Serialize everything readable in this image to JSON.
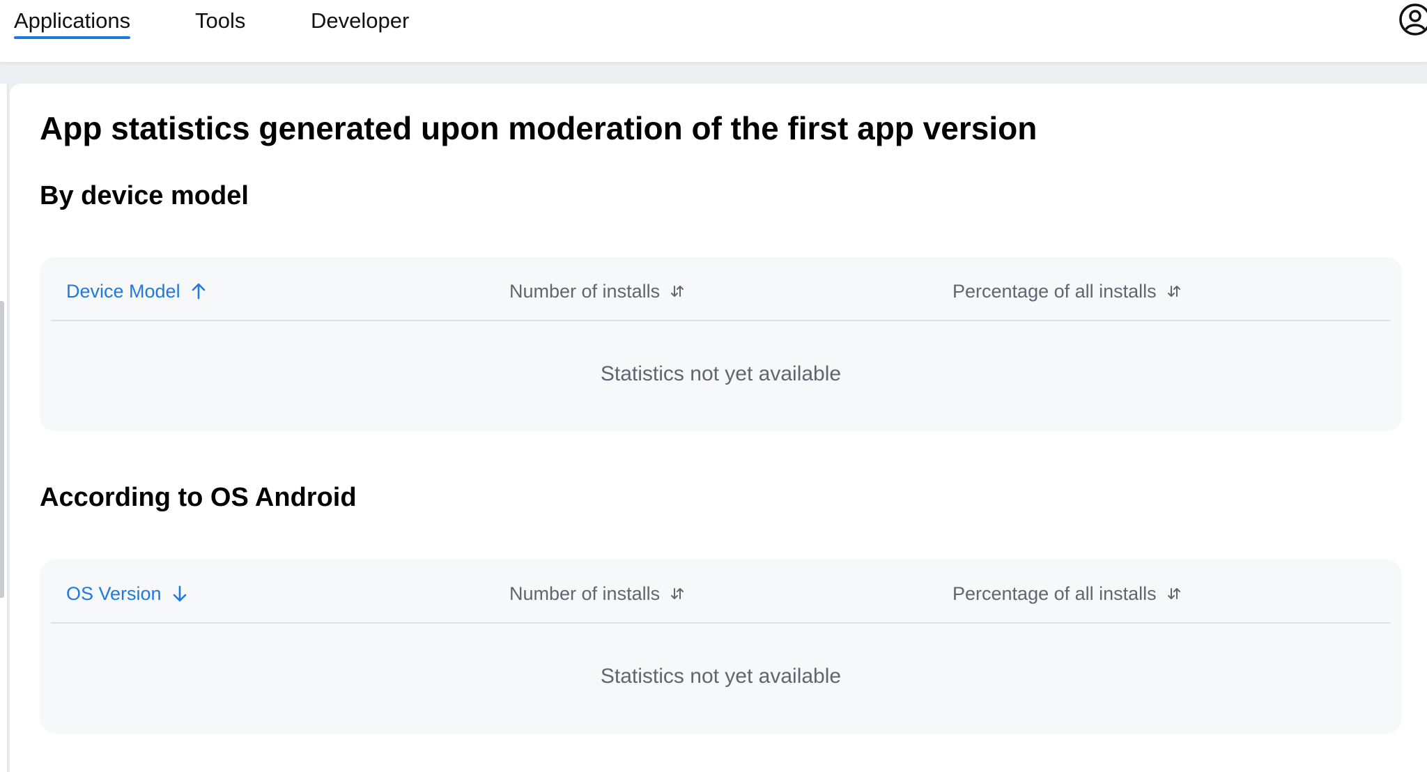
{
  "nav": {
    "tabs": [
      {
        "label": "Applications",
        "active": true
      },
      {
        "label": "Tools",
        "active": false
      },
      {
        "label": "Developer",
        "active": false
      }
    ],
    "avatar_icon": "user-circle-icon"
  },
  "page": {
    "title": "App statistics generated upon moderation of the first app version"
  },
  "sections": [
    {
      "title": "By device model",
      "columns": [
        {
          "label": "Device Model",
          "sort": "ascending",
          "icon": "arrow-up-icon",
          "active": true
        },
        {
          "label": "Number of installs",
          "sort": "none",
          "icon": "sort-arrows-icon",
          "active": false
        },
        {
          "label": "Percentage of all installs",
          "sort": "none",
          "icon": "sort-arrows-icon",
          "active": false
        }
      ],
      "empty_message": "Statistics not yet available"
    },
    {
      "title": "According to OS Android",
      "columns": [
        {
          "label": "OS Version",
          "sort": "descending",
          "icon": "arrow-down-icon",
          "active": true
        },
        {
          "label": "Number of installs",
          "sort": "none",
          "icon": "sort-arrows-icon",
          "active": false
        },
        {
          "label": "Percentage of all installs",
          "sort": "none",
          "icon": "sort-arrows-icon",
          "active": false
        }
      ],
      "empty_message": "Statistics not yet available"
    }
  ],
  "colors": {
    "accent": "#1f7ae0",
    "muted_text": "#5f6670",
    "table_bg": "#f7f8f9",
    "page_bg": "#eceef1"
  }
}
